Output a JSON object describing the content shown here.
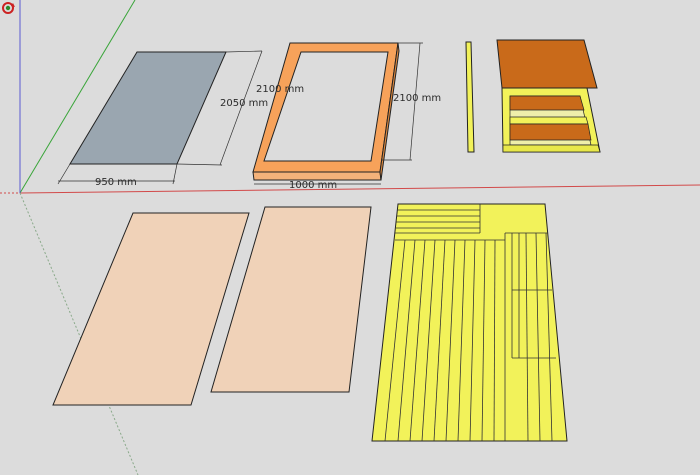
{
  "app": "SketchUp 3D model viewport",
  "colors": {
    "background": "#dcdcdc",
    "axis_red": "#d24a4a",
    "axis_green": "#3aa53a",
    "axis_blue": "#5a5ad2",
    "panel_gray": "#9aa6b0",
    "frame_orange": "#f7a25a",
    "board_orange_dark": "#c96a1a",
    "panel_peach": "#f0d2b8",
    "lumber_yellow": "#f2f25a",
    "edge": "#222222"
  },
  "dimensions": {
    "panel_width": "950 mm",
    "panel_length": "2050 mm",
    "frame_length_top": "2100 mm",
    "frame_length_side": "2100 mm",
    "frame_width": "1000 mm"
  },
  "cursor": {
    "icon": "orbit-cursor-icon"
  }
}
